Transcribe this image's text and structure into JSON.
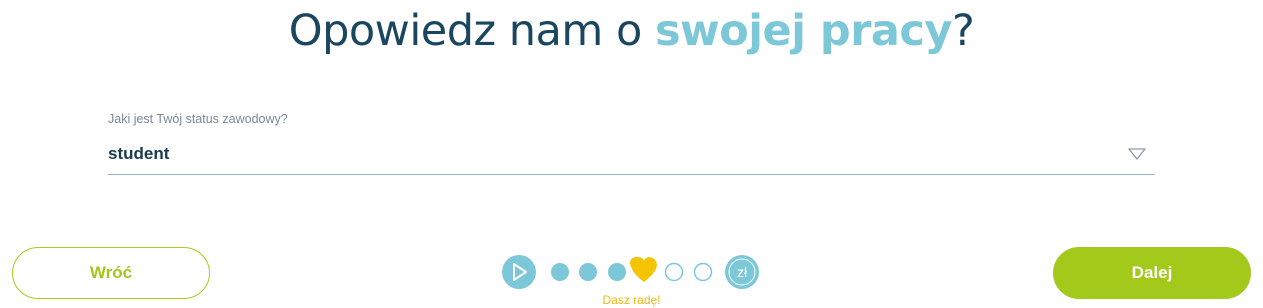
{
  "heading": {
    "part1": "Opowiedz nam o ",
    "accent": "swojej pracy",
    "part2": "?"
  },
  "form": {
    "status_label": "Jaki jest Twój status zawodowy?",
    "status_value": "student"
  },
  "progress": {
    "caption": "Dasz radę!",
    "end_icon_text": "zł",
    "completed_steps": 3,
    "current_step": 4,
    "remaining_steps": 2
  },
  "buttons": {
    "back_label": "Wróć",
    "next_label": "Dalej"
  },
  "colors": {
    "heading": "#1a4660",
    "accent": "#7cc8d8",
    "button_green": "#a3c91b",
    "heart_yellow": "#f5c400"
  }
}
